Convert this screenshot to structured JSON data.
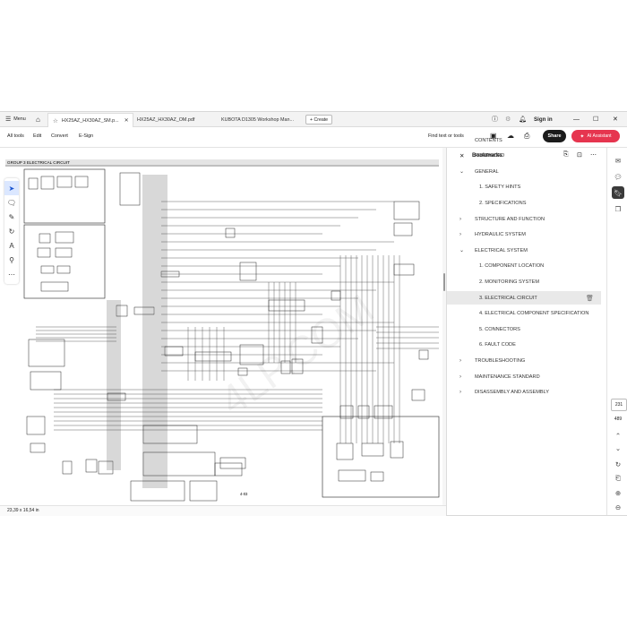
{
  "tabbar": {
    "menu_label": "Menu",
    "tabs": [
      {
        "label": "HX25AZ_HX30AZ_SM.p...",
        "active": true
      },
      {
        "label": "HX25AZ_HX30AZ_OM.pdf",
        "active": false
      },
      {
        "label": "KUBOTA D1305 Workshop Man...",
        "active": false
      }
    ],
    "create_label": "+ Create",
    "signin_label": "Sign in",
    "icons": [
      "hamburger-icon",
      "home-icon",
      "star-icon",
      "close-icon",
      "help-icon",
      "extensions-icon",
      "bell-icon",
      "minimize-icon",
      "maximize-icon",
      "close-window-icon"
    ]
  },
  "toolbar": {
    "items": [
      "All tools",
      "Edit",
      "Convert",
      "E-Sign"
    ],
    "find_label": "Find text or tools",
    "share_label": "Share",
    "ai_label": "AI Assistant",
    "accent": "#e6354f"
  },
  "document": {
    "header_text": "GROUP 3  ELECTRICAL CIRCUIT",
    "page_label": "4-03",
    "watermark": "4LP.COM"
  },
  "status": {
    "page_size": "23,39 x 16,54 in"
  },
  "bookmarks": {
    "title": "Bookmarks",
    "items": [
      {
        "label": "CONTENTS",
        "level": 0,
        "chevron": ""
      },
      {
        "label": "FOREWORD",
        "level": 0,
        "chevron": ""
      },
      {
        "label": "GENERAL",
        "level": 0,
        "chevron": "⌄"
      },
      {
        "label": "1. SAFETY HINTS",
        "level": 1,
        "chevron": ""
      },
      {
        "label": "2. SPECIFICATIONS",
        "level": 1,
        "chevron": ""
      },
      {
        "label": "STRUCTURE AND FUNCTION",
        "level": 0,
        "chevron": "›"
      },
      {
        "label": "HYDRAULIC SYSTEM",
        "level": 0,
        "chevron": "›"
      },
      {
        "label": "ELECTRICAL SYSTEM",
        "level": 0,
        "chevron": "⌄"
      },
      {
        "label": "1. COMPONENT LOCATION",
        "level": 1,
        "chevron": ""
      },
      {
        "label": "2. MONITORING SYSTEM",
        "level": 1,
        "chevron": ""
      },
      {
        "label": "3. ELECTRICAL CIRCUIT",
        "level": 1,
        "chevron": "",
        "selected": true
      },
      {
        "label": "4. ELECTRICAL COMPONENT SPECIFICATION",
        "level": 1,
        "chevron": ""
      },
      {
        "label": "5. CONNECTORS",
        "level": 1,
        "chevron": ""
      },
      {
        "label": "6. FAULT CODE",
        "level": 1,
        "chevron": ""
      },
      {
        "label": "TROUBLESHOOTING",
        "level": 0,
        "chevron": "›"
      },
      {
        "label": "MAINTENANCE STANDARD",
        "level": 0,
        "chevron": "›"
      },
      {
        "label": "DISASSEMBLY AND ASSEMBLY",
        "level": 0,
        "chevron": "›"
      }
    ]
  },
  "navigation": {
    "current_page": "231",
    "total_pages": "489"
  }
}
